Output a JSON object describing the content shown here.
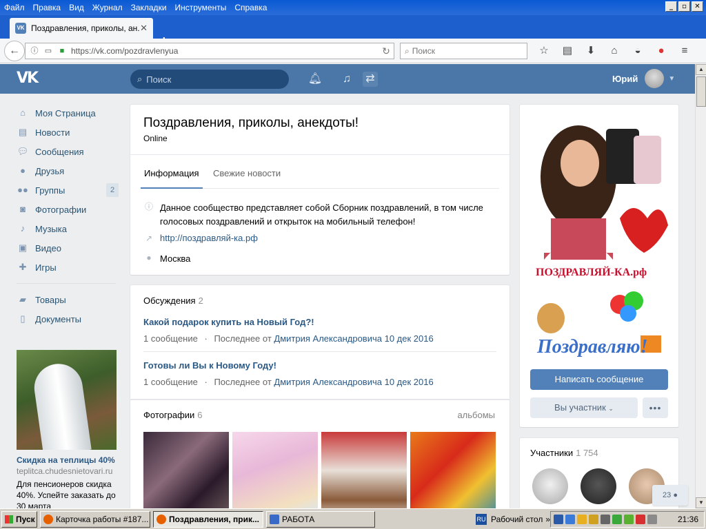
{
  "browser": {
    "menu": [
      "Файл",
      "Правка",
      "Вид",
      "Журнал",
      "Закладки",
      "Инструменты",
      "Справка"
    ],
    "window_buttons": [
      "_",
      "▫",
      "✕"
    ],
    "tab": {
      "favicon": "VK",
      "title": "Поздравления, приколы, ан...",
      "close": "✕"
    },
    "new_tab": "+",
    "url": "https://vk.com/pozdravlenyua",
    "search_placeholder": "Поиск"
  },
  "vk": {
    "logo": "VK",
    "search_placeholder": "Поиск",
    "user_name": "Юрий",
    "nav": [
      {
        "label": "Моя Страница",
        "icon": "home-icon"
      },
      {
        "label": "Новости",
        "icon": "news-icon"
      },
      {
        "label": "Сообщения",
        "icon": "messages-icon"
      },
      {
        "label": "Друзья",
        "icon": "friends-icon"
      },
      {
        "label": "Группы",
        "icon": "groups-icon",
        "badge": "2"
      },
      {
        "label": "Фотографии",
        "icon": "camera-icon"
      },
      {
        "label": "Музыка",
        "icon": "music-icon"
      },
      {
        "label": "Видео",
        "icon": "video-icon"
      },
      {
        "label": "Игры",
        "icon": "games-icon"
      }
    ],
    "nav2": [
      {
        "label": "Товары",
        "icon": "market-icon"
      },
      {
        "label": "Документы",
        "icon": "docs-icon"
      }
    ],
    "ad": {
      "title": "Скидка на теплицы 40%",
      "domain": "teplitca.chudesnietovari.ru",
      "text": "Для пенсионеров скидка 40%. Успейте заказать до 30 марта"
    }
  },
  "group": {
    "title": "Поздравления, приколы, анекдоты!",
    "status": "Online",
    "tabs": [
      "Информация",
      "Свежие новости"
    ],
    "description": "Данное сообщество представляет собой Сборник поздравлений, в том числе голосовых поздравлений и открыток на мобильный телефон!",
    "link": "http://поздравляй-ка.рф",
    "city": "Москва"
  },
  "discussions": {
    "title": "Обсуждения",
    "count": "2",
    "topics": [
      {
        "title": "Какой подарок купить на Новый Год?!",
        "count": "1 сообщение",
        "sep": "·",
        "last_prefix": "Последнее от",
        "last_author": "Дмитрия Александровича",
        "last_date": "10 дек 2016"
      },
      {
        "title": "Готовы ли Вы к Новому Году!",
        "count": "1 сообщение",
        "sep": "·",
        "last_prefix": "Последнее от",
        "last_author": "Дмитрия Александровича",
        "last_date": "10 дек 2016"
      }
    ]
  },
  "photos": {
    "title": "Фотографии",
    "count": "6",
    "albums_link": "альбомы"
  },
  "cover": {
    "brand_text": "ПОЗДРАВЛЯЙ-КА.рф",
    "greeting_text": "Поздравляю!",
    "message_button": "Написать сообщение",
    "member_button": "Вы участник",
    "more_button": "•••"
  },
  "members": {
    "title": "Участники",
    "count": "1 754"
  },
  "float_counter": "23",
  "taskbar": {
    "start": "Пуск",
    "tasks": [
      "Карточка работы #187...",
      "Поздравления, прик...",
      "РАБОТА"
    ],
    "desktop_label": "Рабочий стол",
    "lang": "RU",
    "clock": "21:36"
  },
  "colors": {
    "vk_header": "#4a76a8",
    "vk_link": "#2a5885",
    "vk_button": "#5181b8",
    "page_bg": "#edeef0",
    "brand_red": "#c8102e"
  }
}
